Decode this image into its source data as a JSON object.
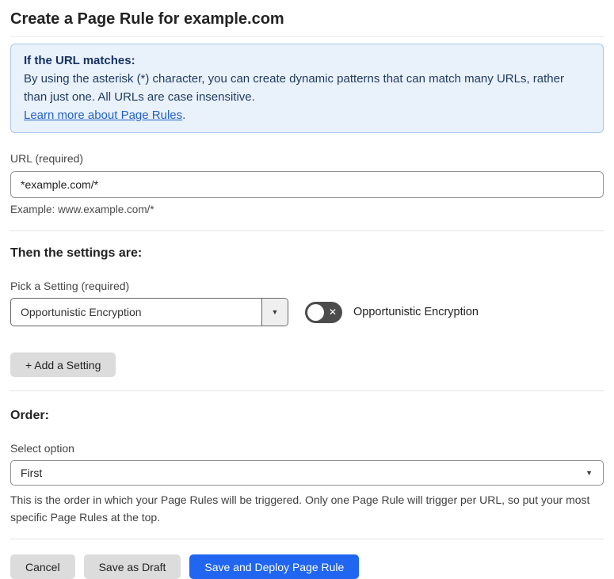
{
  "page": {
    "title": "Create a Page Rule for example.com"
  },
  "info_box": {
    "heading": "If the URL matches:",
    "body": "By using the asterisk (*) character, you can create dynamic patterns that can match many URLs, rather than just one. All URLs are case insensitive.",
    "link_label": "Learn more about Page Rules",
    "link_suffix": "."
  },
  "url_field": {
    "label": "URL (required)",
    "value": "*example.com/*",
    "example": "Example: www.example.com/*"
  },
  "settings": {
    "heading": "Then the settings are:",
    "pick_label": "Pick a Setting (required)",
    "selected_option": "Opportunistic Encryption",
    "dropdown_arrow": "▼",
    "toggle_state": "off",
    "toggle_x": "✕",
    "toggle_label": "Opportunistic Encryption",
    "add_button_label": "+ Add a Setting"
  },
  "order": {
    "heading": "Order:",
    "label": "Select option",
    "selected_option": "First",
    "dropdown_arrow": "▼",
    "help": "This is the order in which your Page Rules will be triggered. Only one Page Rule will trigger per URL, so put your most specific Page Rules at the top."
  },
  "actions": {
    "cancel": "Cancel",
    "save_draft": "Save as Draft",
    "save_deploy": "Save and Deploy Page Rule"
  },
  "colors": {
    "primary_blue": "#2066f0",
    "info_bg": "#e9f1fb",
    "info_border": "#a9c8ee",
    "info_text": "#1e3a5f",
    "link_blue": "#2262c9",
    "toggle_off_bg": "#4c4c4c"
  }
}
